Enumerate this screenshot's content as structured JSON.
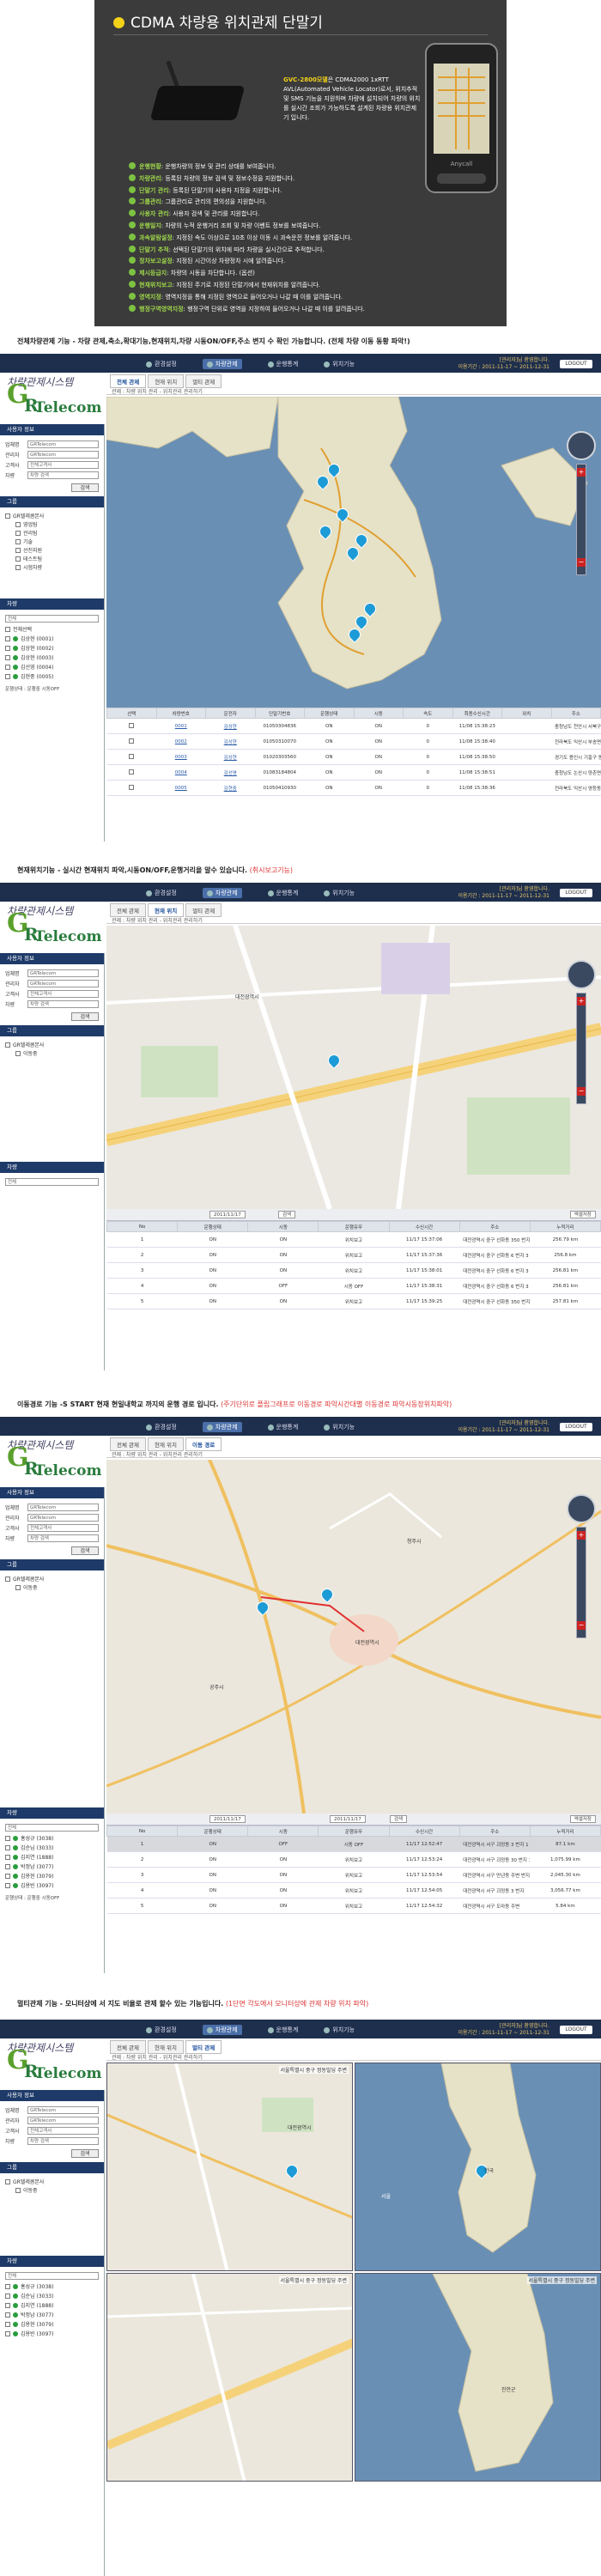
{
  "hero": {
    "title": "CDMA 차량용 위치관제 단말기",
    "model": "GVC-2800모델",
    "model_desc": "은 CDMA2000 1xRTT AVL(Automated Vehicle Locator)로서, 위치추적 및 SMS 기능을 지원하며 차량에 설치되어 차량의 위치를 실시간 조회가 가능하도록 설계된 차량용 위치관제기 입니다.",
    "phone_brand": "Anycall",
    "features": [
      {
        "name": "운행현황",
        "desc": ": 운행차량의 정보 및 관리 상태를 보여줍니다."
      },
      {
        "name": "차량관리",
        "desc": ": 등록된 차량의 정보 검색 및 정보수정을 지원합니다."
      },
      {
        "name": "단말기 관리",
        "desc": ": 등록된 단말기의 사용자 지정을 지원합니다."
      },
      {
        "name": "그룹관리",
        "desc": ": 그룹관리로 관리의 편의성을 지원합니다."
      },
      {
        "name": "사용자 관리",
        "desc": ": 사용자 검색 및 관리를 지원합니다."
      },
      {
        "name": "운행일지",
        "desc": ": 차량의 누적 운행거리 조회 및 차량 이벤트 정보를 보여줍니다."
      },
      {
        "name": "과속알람설정",
        "desc": ": 지정된 속도 이상으로 10초 이상 이동 시 과속운전 정보를 알려줍니다."
      },
      {
        "name": "단말기 추적",
        "desc": ": 선택된 단말기의 위치에 따라 차량을 실시간으로 추적합니다."
      },
      {
        "name": "정차보고설정",
        "desc": ": 지정된 시간이상 차량정차 시에 알려줍니다."
      },
      {
        "name": "제시등급지",
        "desc": ": 차량의 시동을 차단합니다. (옵션)"
      },
      {
        "name": "현재위치보고",
        "desc": ": 지정된 주기로 지정된 단말기에서 현재위치를 알려줍니다."
      },
      {
        "name": "영역지정",
        "desc": ": 영역지정을 통해 지정된 영역으로 들어오거나 나갈 때 이를 알려줍니다."
      },
      {
        "name": "행정구역영역지정",
        "desc": ": 행정구역 단위로 영역을 지정하여 들어오거나 나갈 때 이를 알려줍니다."
      }
    ]
  },
  "captions": {
    "s1": "전체차량관제 기능 - 차량 관제,축소,확대기능,현재위치,차량 시동ON/OFF,주소 변지 수 확인 가능합니다. (전체 차량 이동 동황 파악!)",
    "s2_a": "현재위치기능 - 실시간 현재위치 파악,시동ON/OFF,운행거리을 알수 있습니다.",
    "s2_b": "(취시보고기능)",
    "s3_a": "이동경로 기능 -S START 현재 현일내학교 까지의 운행 경로 입니다.",
    "s3_b": "(주기단위로 플립그래프로 이동경로 파악시간대별 이동경로 파악시동장위치파악)",
    "s4_a": "멀티관제 기능 - 모니터상에 서 지도 비율로 관제 할수 있는 기능입니다.",
    "s4_b": "(1단면 각도에서 모니터상에 관제 차량 위치 파악)"
  },
  "app": {
    "top_nav": [
      "환경설정",
      "차량관제",
      "운행통계",
      "위치기능"
    ],
    "active_nav": "차량관제",
    "welcome_line1": "[관리자]님 환영합니다.",
    "welcome_line2": "이용기간 : 2011-11-17 ~ 2011-12-31",
    "logout": "LOGOUT",
    "logo_cursive": "차량관제시스템",
    "logo_g": "G",
    "logo_r": "R",
    "logo_text": "Telecom",
    "sub_tabs": [
      "전체 관제",
      "현재 위치",
      "멀티 관제"
    ],
    "sub_tabs_s3": [
      "전체 관제",
      "현재 위치",
      "이동 경로"
    ],
    "crumb": "관제 : 차량 위치 관리 - 위치관리 관리하기",
    "sidebar_head": "사용자 정보",
    "form": {
      "company_label": "업체명",
      "company_value": "GRTelecom",
      "company2_label": "관리자",
      "company2_value": "GRTelecom",
      "user_label": "고객사",
      "user_value": "전체고객사",
      "vehicle_label": "차량",
      "vehicle_value": "차량 검색"
    },
    "search_btn": "검색",
    "group_head": "그룹",
    "group_root": "GR텔레콤본사",
    "group_children": [
      "영업팀",
      "관리팀",
      "기술",
      "선진지원",
      "테스트팀",
      "시험차량"
    ],
    "vehicle_head": "차량",
    "vehicle_filter": "전체",
    "all_select": "전체선택",
    "vehicles": [
      {
        "name": "김상현",
        "no": "(0001)"
      },
      {
        "name": "김상현",
        "no": "(0002)"
      },
      {
        "name": "김상현",
        "no": "(0003)"
      },
      {
        "name": "김선영",
        "no": "(0004)"
      },
      {
        "name": "김현중",
        "no": "(0005)"
      }
    ],
    "vehicles_s3": [
      {
        "name": "홍성규",
        "no": "(3038)"
      },
      {
        "name": "김순님",
        "no": "(3033)"
      },
      {
        "name": "김지연",
        "no": "(1888)"
      },
      {
        "name": "박정남",
        "no": "(3077)"
      },
      {
        "name": "김용현",
        "no": "(3079)"
      },
      {
        "name": "김용빈",
        "no": "(3097)"
      }
    ],
    "legend": "운행상태 : 운행중  시동OFF",
    "single_vehicle": "이동중"
  },
  "map_labels": {
    "seoul": "서울",
    "daejeon": "대전광역시",
    "gongju": "공주시",
    "cheongju": "청주시",
    "korea": "한국",
    "quad_title": "서울특별시 중구 정동빌딩 주변",
    "jinan": "진안군"
  },
  "grid1": {
    "headers": [
      "선택",
      "차량번호",
      "운전자",
      "단말기번호",
      "운행상태",
      "시동",
      "속도",
      "최종수신시간",
      "위치",
      "주소"
    ],
    "rows": [
      [
        "0001",
        "김상현",
        "01050304836",
        "ON",
        "ON",
        "0",
        "11/08 15:38:23",
        "",
        "충청남도 천안시 서북구 두정동 6 그 - 16 대로 입 주"
      ],
      [
        "0002",
        "김상현",
        "01050310070",
        "ON",
        "ON",
        "0",
        "11/08 15:38:40",
        "",
        "전라북도 익산시 부송면 장팡읍 1203 연면 1 호"
      ],
      [
        "0003",
        "김상현",
        "01020303560",
        "ON",
        "ON",
        "0",
        "11/08 15:38:50",
        "",
        "경기도 용인시 기흥구 동백동 제 6 번 연 주 1 호"
      ],
      [
        "0004",
        "김선영",
        "01083184804",
        "ON",
        "ON",
        "0",
        "11/08 15:38:51",
        "",
        "충청남도 논산시 양촌면 산직리 90 번지"
      ],
      [
        "0005",
        "김현중",
        "01050410930",
        "ON",
        "ON",
        "0",
        "11/08 15:38:36",
        "",
        "전라북도 익산시 영등동 120 번지 1 호"
      ]
    ]
  },
  "grid2": {
    "toolbar_date": "2011/11/17",
    "toolbar_btn": "검색",
    "excel": "엑셀저장",
    "headers": [
      "No",
      "운행상태",
      "시동",
      "운행유무",
      "수신시간",
      "주소",
      "누적거리"
    ],
    "rows": [
      [
        "1",
        "ON",
        "ON",
        "위치보고",
        "11/17 15:37:06",
        "대전광역시 중구 선화동 350 번지 1 호",
        "256.79 km"
      ],
      [
        "2",
        "ON",
        "ON",
        "위치보고",
        "11/17 15:37:36",
        "대전광역시 중구 선화동 6 번지 3 호",
        "256.8 km"
      ],
      [
        "3",
        "ON",
        "ON",
        "위치보고",
        "11/17 15:38:01",
        "대전광역시 중구 선화동 6 번지 3 호",
        "256.81 km"
      ],
      [
        "4",
        "ON",
        "OFF",
        "시동 OFF",
        "11/17 15:38:31",
        "대전광역시 중구 선화동 6 번지 3 호",
        "256.81 km"
      ],
      [
        "5",
        "ON",
        "ON",
        "위치보고",
        "11/17 15:39:25",
        "대전광역시 중구 선화동 350 번지 1 호",
        "257.81 km"
      ]
    ]
  },
  "grid3": {
    "toolbar_from": "2011/11/17",
    "toolbar_to": "2011/11/17",
    "toolbar_btn": "검색",
    "excel": "엑셀저장",
    "headers": [
      "No",
      "운행상태",
      "시동",
      "운행유무",
      "수신시간",
      "주소",
      "누적거리"
    ],
    "rows": [
      [
        "1",
        "ON",
        "OFF",
        "시동 OFF",
        "11/17 12:52:47",
        "대전광역시 서구 괴정동 3 번지 1 호",
        "87.1 km"
      ],
      [
        "2",
        "ON",
        "ON",
        "위치보고",
        "11/17 12:53:24",
        "대전광역시 서구 괴정동 30 번지 10 호",
        "1,075.99 km"
      ],
      [
        "3",
        "ON",
        "ON",
        "위치보고",
        "11/17 12:53:54",
        "대전광역시 서구 만년동 주변 번지",
        "2,045.30 km"
      ],
      [
        "4",
        "ON",
        "ON",
        "위치보고",
        "11/17 12:54:05",
        "대전광역시 서구 괴정동 3 번지",
        "3,056.77 km"
      ],
      [
        "5",
        "ON",
        "ON",
        "위치보고",
        "11/17 12:54:32",
        "대전광역시 서구 도마동 주변",
        "5.84 km"
      ]
    ]
  },
  "colors": {
    "navy": "#1e2f4d",
    "accent_green": "#7dc242",
    "pin_blue": "#1d9bd6",
    "highlight_red": "#d33"
  }
}
